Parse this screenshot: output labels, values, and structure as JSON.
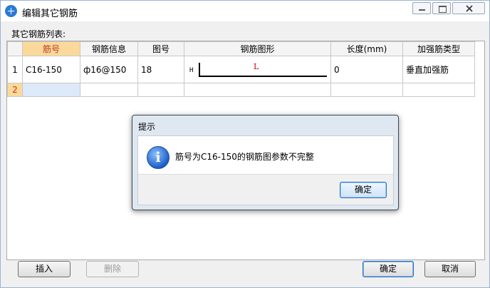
{
  "window": {
    "title": "编辑其它钢筋"
  },
  "list_label": "其它钢筋列表:",
  "table": {
    "columns": [
      "筋号",
      "钢筋信息",
      "图号",
      "钢筋图形",
      "长度(mm)",
      "加强筋类型"
    ],
    "rows": [
      {
        "num": "1",
        "bar_no": "C16-150",
        "bar_info": "ф16@150",
        "fig_no": "18",
        "shape_h": "H",
        "shape_l": "L",
        "length": "0",
        "rib_type": "垂直加强筋"
      },
      {
        "num": "2",
        "bar_no": "",
        "bar_info": "",
        "fig_no": "",
        "shape_h": "",
        "shape_l": "",
        "length": "",
        "rib_type": ""
      }
    ]
  },
  "buttons": {
    "insert": "插入",
    "delete": "删除",
    "ok": "确定",
    "cancel": "取消"
  },
  "dialog": {
    "title": "提示",
    "message": "筋号为C16-150的钢筋图参数不完整",
    "ok": "确定"
  }
}
